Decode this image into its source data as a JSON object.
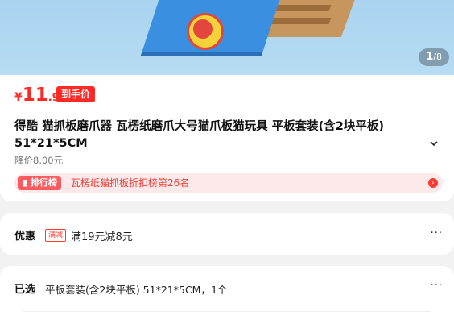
{
  "gallery": {
    "current": "1",
    "total": "/8"
  },
  "product": {
    "currency": "¥",
    "price_int": "11",
    "price_dec": ".90",
    "price_tag": "到手价",
    "title": "得酷 猫抓板磨爪器 瓦楞纸磨爪大号猫爪板猫玩具 平板套装(含2块平板) 51*21*5CM",
    "original_price": "降价8.00元"
  },
  "ranking": {
    "badge": "排行榜",
    "text": "瓦楞纸猫抓板折扣榜第26名"
  },
  "promotion": {
    "label": "优惠",
    "badge": "满减",
    "text": "满19元减8元",
    "more": "···"
  },
  "selection": {
    "label": "已选",
    "text": "平板套装(含2块平板) 51*21*5CM，1个",
    "more": "···"
  },
  "colors": {
    "accent": "#ff2a25",
    "rank_bg": "#fde8ea"
  }
}
